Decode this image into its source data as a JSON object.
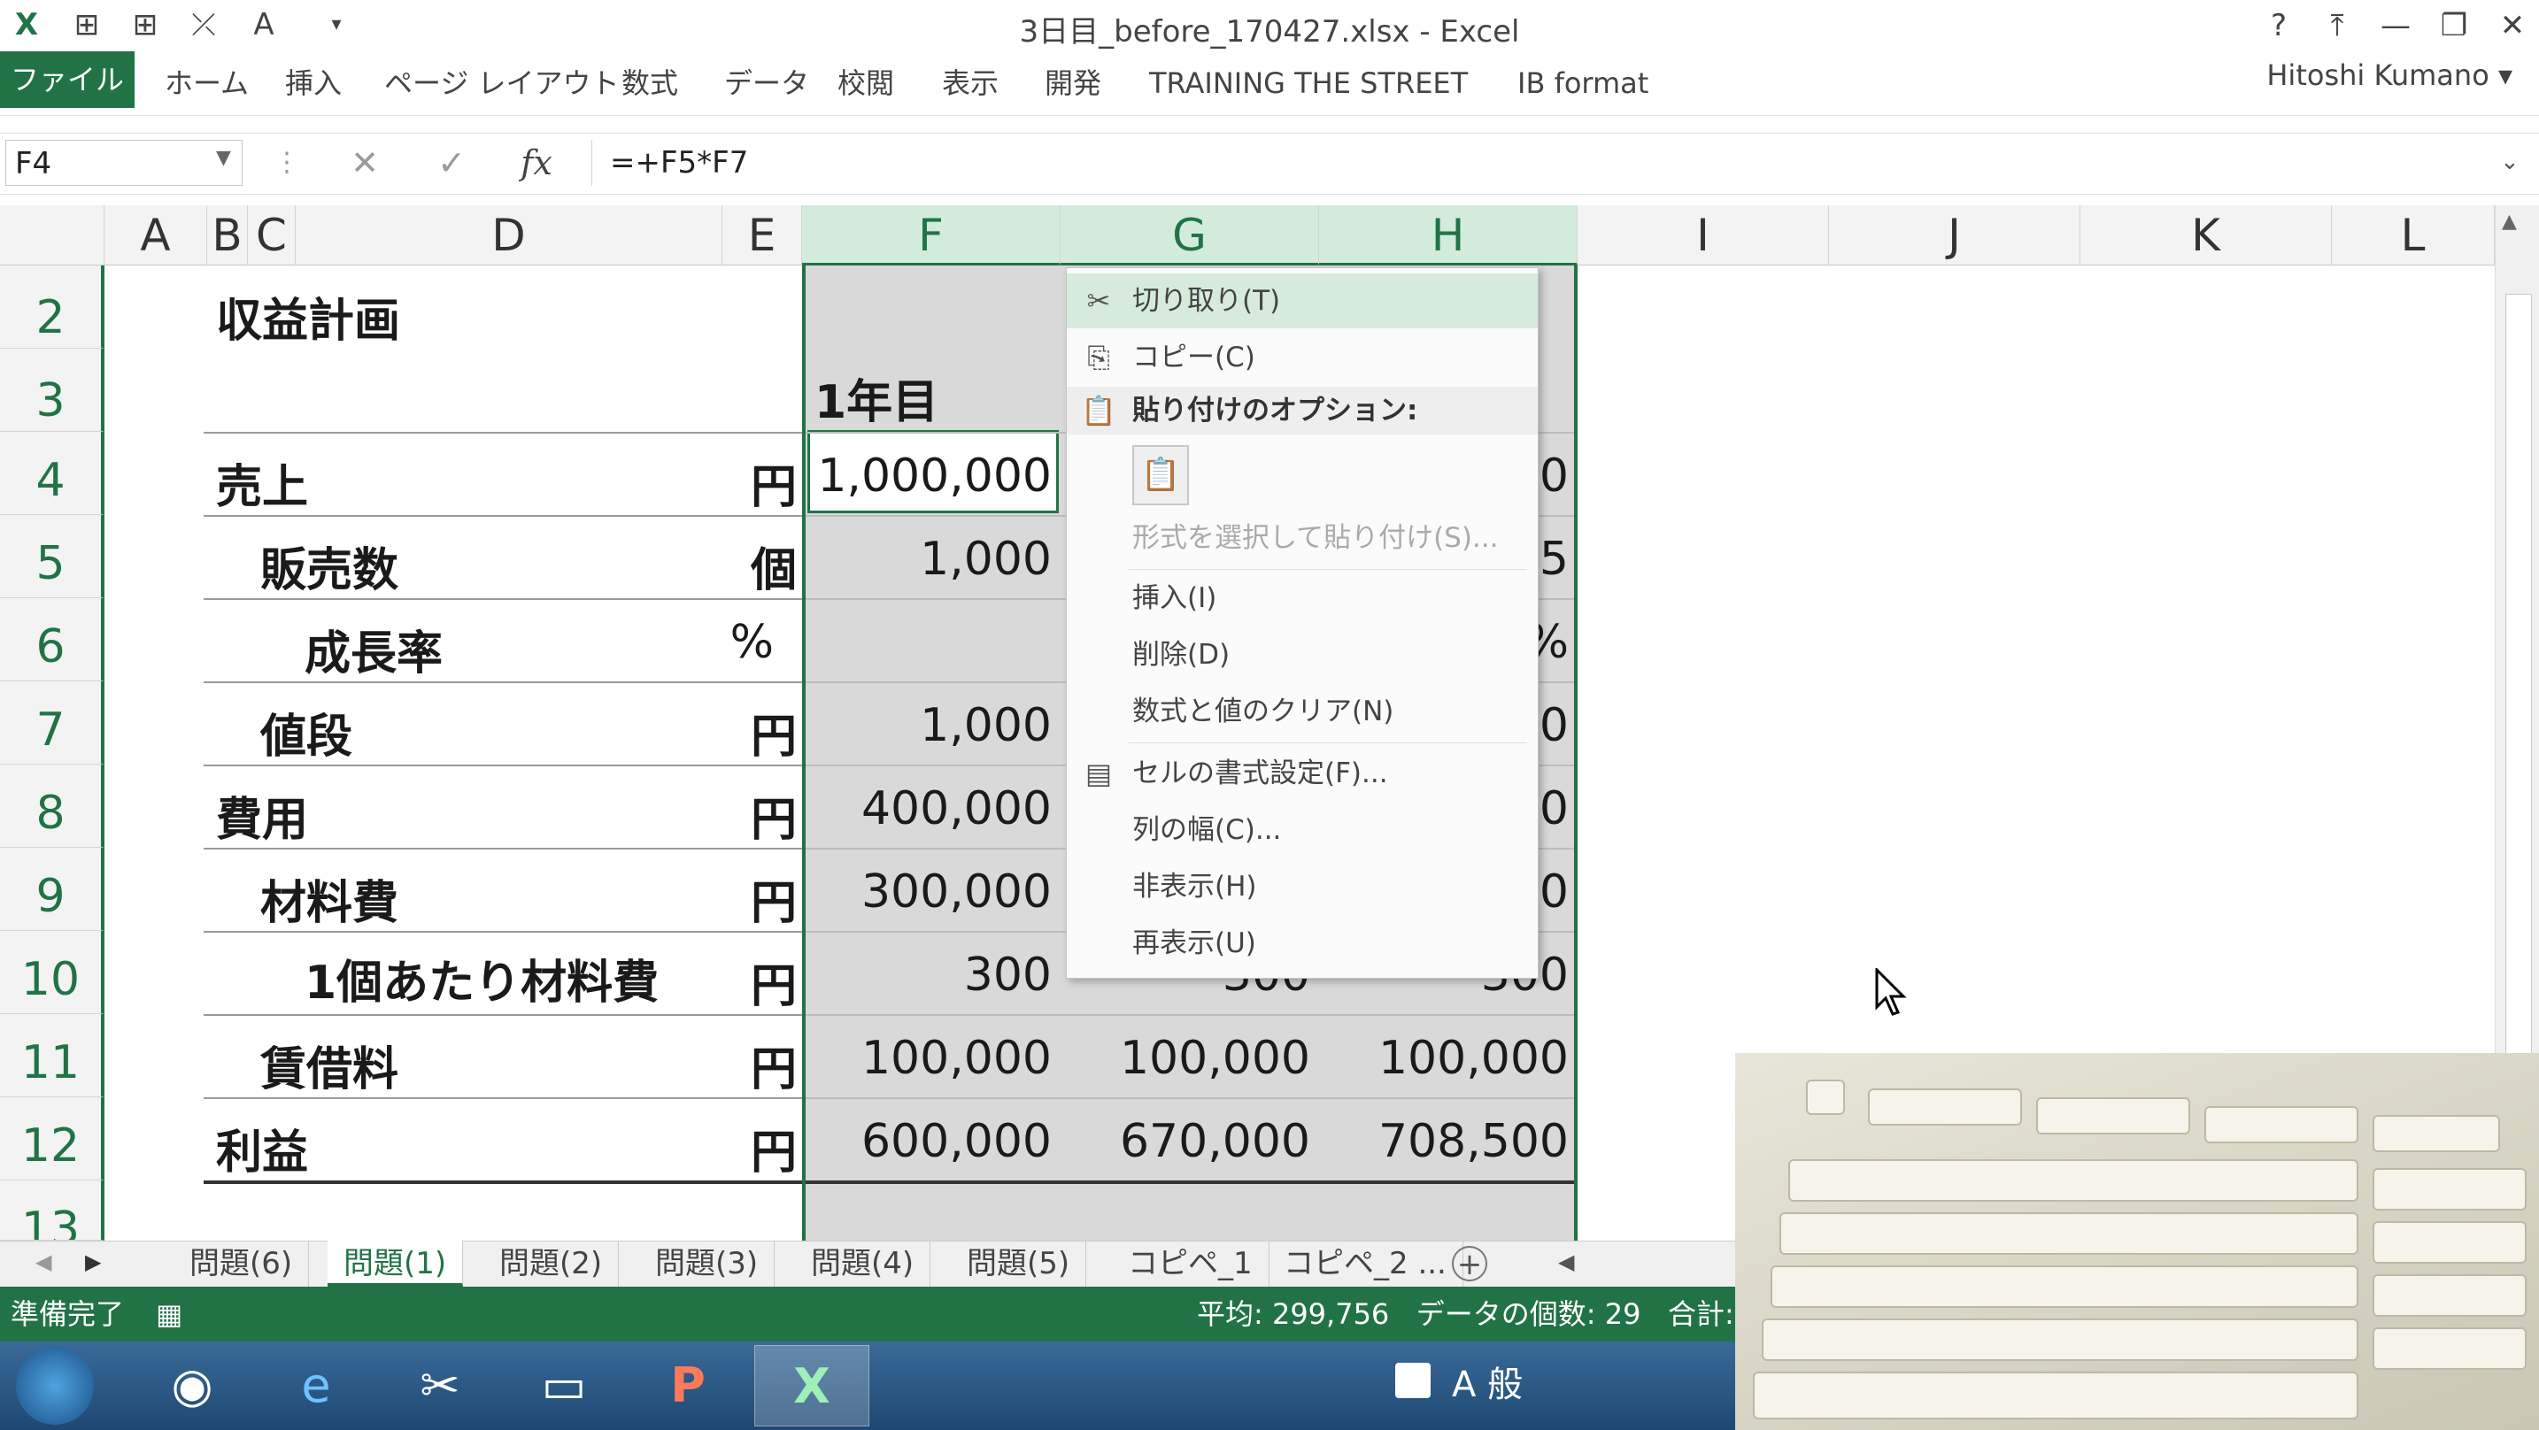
{
  "window": {
    "title": "3日目_before_170427.xlsx - Excel",
    "buttons": [
      "?",
      "⤒",
      "—",
      "❐",
      "✕"
    ]
  },
  "ribbon": {
    "tabs": [
      "ファイル",
      "ホーム",
      "挿入",
      "ページ レイアウト",
      "数式",
      "データ",
      "校閲",
      "表示",
      "開発",
      "TRAINING THE STREET",
      "IB format"
    ],
    "user": "Hitoshi Kumano ▾"
  },
  "formula_bar": {
    "name_box": "F4",
    "formula": "=+F5*F7"
  },
  "columns": [
    "A",
    "B",
    "C",
    "D",
    "E",
    "F",
    "G",
    "H",
    "I",
    "J",
    "K",
    "L"
  ],
  "rows": [
    {
      "num": "2",
      "label": "収益計画",
      "unit": "",
      "f": "",
      "g": "",
      "h": ""
    },
    {
      "num": "3",
      "label": "",
      "unit": "",
      "f": "1年目",
      "g": "",
      "h": ""
    },
    {
      "num": "4",
      "label": "売上",
      "unit": "円",
      "f": "1,000,000",
      "g": "",
      "h": "0"
    },
    {
      "num": "5",
      "label": "販売数",
      "unit": "個",
      "f": "1,000",
      "g": "",
      "h": "5"
    },
    {
      "num": "6",
      "label": "成長率",
      "unit": "%",
      "f": "",
      "g": "",
      "h": "%"
    },
    {
      "num": "7",
      "label": "値段",
      "unit": "円",
      "f": "1,000",
      "g": "",
      "h": "0"
    },
    {
      "num": "8",
      "label": "費用",
      "unit": "円",
      "f": "400,000",
      "g": "",
      "h": "0"
    },
    {
      "num": "9",
      "label": "材料費",
      "unit": "円",
      "f": "300,000",
      "g": "",
      "h": "0"
    },
    {
      "num": "10",
      "label": "1個あたり材料費",
      "unit": "円",
      "f": "300",
      "g": "300",
      "h": "300"
    },
    {
      "num": "11",
      "label": "賃借料",
      "unit": "円",
      "f": "100,000",
      "g": "100,000",
      "h": "100,000"
    },
    {
      "num": "12",
      "label": "利益",
      "unit": "円",
      "f": "600,000",
      "g": "670,000",
      "h": "708,500"
    },
    {
      "num": "13",
      "label": "",
      "unit": "",
      "f": "",
      "g": "",
      "h": ""
    }
  ],
  "context_menu": {
    "items": [
      {
        "icon": "✂",
        "label": "切り取り(T)"
      },
      {
        "icon": "⎘",
        "label": "コピー(C)"
      },
      {
        "icon": "📋",
        "label": "貼り付けのオプション:"
      },
      {
        "icon": "",
        "label": "形式を選択して貼り付け(S)..."
      },
      {
        "icon": "",
        "label": "挿入(I)"
      },
      {
        "icon": "",
        "label": "削除(D)"
      },
      {
        "icon": "",
        "label": "数式と値のクリア(N)"
      },
      {
        "icon": "▤",
        "label": "セルの書式設定(F)..."
      },
      {
        "icon": "",
        "label": "列の幅(C)..."
      },
      {
        "icon": "",
        "label": "非表示(H)"
      },
      {
        "icon": "",
        "label": "再表示(U)"
      }
    ]
  },
  "sheet_tabs": [
    "問題(6)",
    "問題(1)",
    "問題(2)",
    "問題(3)",
    "問題(4)",
    "問題(5)",
    "コピペ_1",
    "コピペ_2 ..."
  ],
  "active_sheet": "問題(1)",
  "status": {
    "ready": "準備完了",
    "summary": "平均: 299,756   データの個数: 29   合計: "
  },
  "taskbar": {
    "ime": "A 般"
  },
  "colors": {
    "excel_green": "#217346",
    "selected_col_header": "#d3ebdb",
    "gray_fill": "#d9d9d9"
  }
}
